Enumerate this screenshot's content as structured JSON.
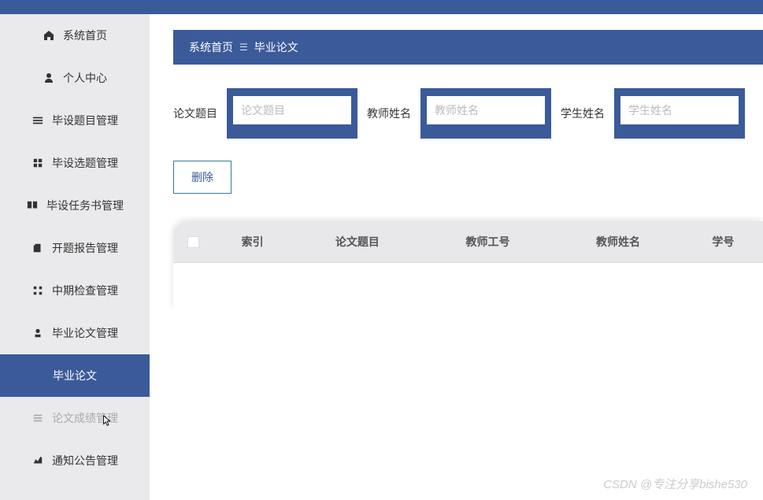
{
  "sidebar": {
    "items": [
      {
        "label": "系统首页",
        "icon": "home"
      },
      {
        "label": "个人中心",
        "icon": "person"
      },
      {
        "label": "毕设题目管理",
        "icon": "menu"
      },
      {
        "label": "毕设选题管理",
        "icon": "grid"
      },
      {
        "label": "毕设任务书管理",
        "icon": "clipboard"
      },
      {
        "label": "开题报告管理",
        "icon": "report"
      },
      {
        "label": "中期检查管理",
        "icon": "check"
      },
      {
        "label": "毕业论文管理",
        "icon": "user"
      },
      {
        "label": "毕业论文",
        "icon": "",
        "active": true
      },
      {
        "label": "论文成绩管理",
        "icon": "table",
        "disabled": true
      },
      {
        "label": "通知公告管理",
        "icon": "chart"
      }
    ]
  },
  "breadcrumb": {
    "home": "系统首页",
    "current": "毕业论文"
  },
  "search": {
    "field1": {
      "label": "论文题目",
      "placeholder": "论文题目"
    },
    "field2": {
      "label": "教师姓名",
      "placeholder": "教师姓名"
    },
    "field3": {
      "label": "学生姓名",
      "placeholder": "学生姓名"
    }
  },
  "actions": {
    "delete": "删除"
  },
  "table": {
    "columns": [
      "索引",
      "论文题目",
      "教师工号",
      "教师姓名",
      "学号"
    ]
  },
  "watermark": "CSDN @专注分享bishe530"
}
